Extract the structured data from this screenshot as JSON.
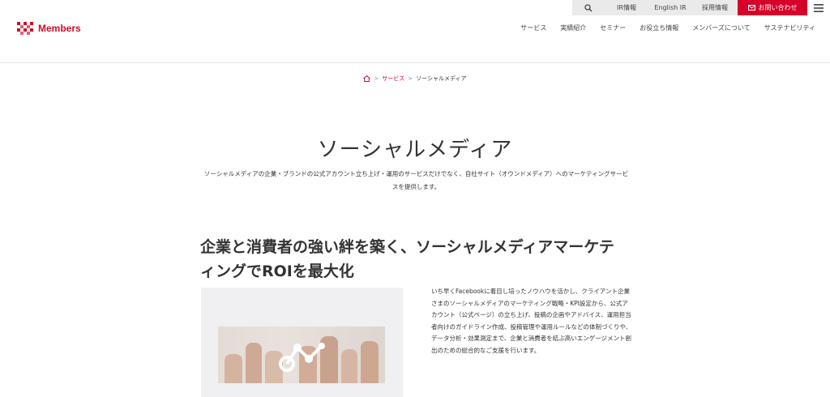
{
  "utility": {
    "ir_label": "IR情報",
    "english_label": "English IR",
    "recruit_label": "採用情報",
    "contact_label": "お問い合わせ"
  },
  "logo": {
    "text": "Members"
  },
  "nav": {
    "items": [
      "サービス",
      "実績紹介",
      "セミナー",
      "お役立ち情報",
      "メンバーズについて",
      "サステナビリティ"
    ]
  },
  "breadcrumb": {
    "service": "サービス",
    "current": "ソーシャルメディア",
    "separator": ">"
  },
  "page": {
    "title": "ソーシャルメディア",
    "lead_line1": "ソーシャルメディアの企業・ブランドの公式アカウント立ち上げ・運用のサービスだけでなく、自社サイト（オウンドメディア）へのマーケティングサービ",
    "lead_line2": "スを提供します。"
  },
  "section": {
    "heading_line1": "企業と消費者の強い絆を築く、ソーシャルメディアマーケテ",
    "heading_line2": "ィングでROIを最大化",
    "body_lines": [
      "いち早くFacebookに着目し培ったノウハウを活かし、クライアント企業",
      "さまのソーシャルメディアのマーケティング戦略・KPI設定から、公式ア",
      "カウント（公式ページ）の立ち上げ、投稿の企画やアドバイス、運用担当",
      "者向けのガイドライン作成、投稿管理や運用ルールなどの体制づくりや、",
      "データ分析・効果測定まで、企業と消費者を結ぶ高いエンゲージメント創",
      "出のための総合的なご支援を行います。"
    ]
  },
  "colors": {
    "brand": "#d6002a",
    "utility_bg": "#eaeaea",
    "panel_bg": "#f0f0f2"
  },
  "icons": [
    "search-icon",
    "mail-icon",
    "hamburger-menu-icon",
    "home-icon",
    "share-network-icon"
  ]
}
